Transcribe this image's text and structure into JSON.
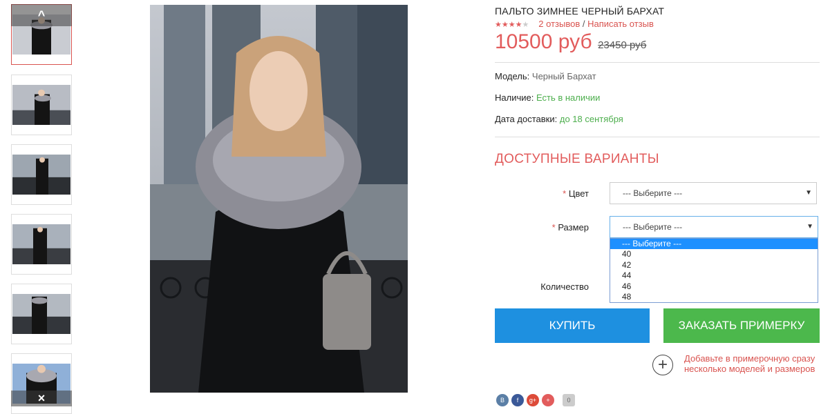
{
  "thumbnails": {
    "up_icon": "chevron-up-icon",
    "down_icon": "close-icon",
    "up_label": "^",
    "down_label": "×"
  },
  "product": {
    "title": "ПАЛЬТО ЗИМНЕЕ ЧЕРНЫЙ БАРХАТ",
    "rating": 4,
    "rating_max": 5,
    "reviews_label": "2 отзывов",
    "separator": " / ",
    "write_review_label": "Написать отзыв",
    "price": "10500 руб",
    "old_price": "23450 руб",
    "model_label": "Модель:",
    "model_value": "Черный Бархат",
    "availability_label": "Наличие:",
    "availability_value": "Есть в наличии",
    "delivery_label": "Дата доставки:",
    "delivery_value": "до 18 сентября"
  },
  "variants": {
    "title": "ДОСТУПНЫЕ ВАРИАНТЫ",
    "required_mark": "*",
    "color_label": "Цвет",
    "color_value": "--- Выберите ---",
    "size_label": "Размер",
    "size_value": "--- Выберите ---",
    "quantity_label": "Количество",
    "size_options": [
      "--- Выберите ---",
      "40",
      "42",
      "44",
      "46",
      "48"
    ],
    "selected_option_index": 0
  },
  "actions": {
    "buy_label": "КУПИТЬ",
    "try_label": "ЗАКАЗАТЬ ПРИМЕРКУ",
    "add_fitting_text": "Добавьте в примерочную сразу несколько моделей и размеров"
  },
  "social": {
    "items": [
      {
        "name": "vk-icon",
        "glyph": "В",
        "color": "#5b7fa6"
      },
      {
        "name": "facebook-icon",
        "glyph": "f",
        "color": "#3b5998"
      },
      {
        "name": "google-plus-icon",
        "glyph": "g+",
        "color": "#dd4b39"
      },
      {
        "name": "odnoklassniki-icon",
        "glyph": "+",
        "color": "#e25c5c"
      },
      {
        "name": "share-count",
        "glyph": "0",
        "color": "#cccccc"
      }
    ]
  },
  "colors": {
    "accent_red": "#e25c5c",
    "buy_blue": "#1e90e0",
    "try_green": "#4cb84c",
    "in_stock_green": "#4cae4c"
  }
}
